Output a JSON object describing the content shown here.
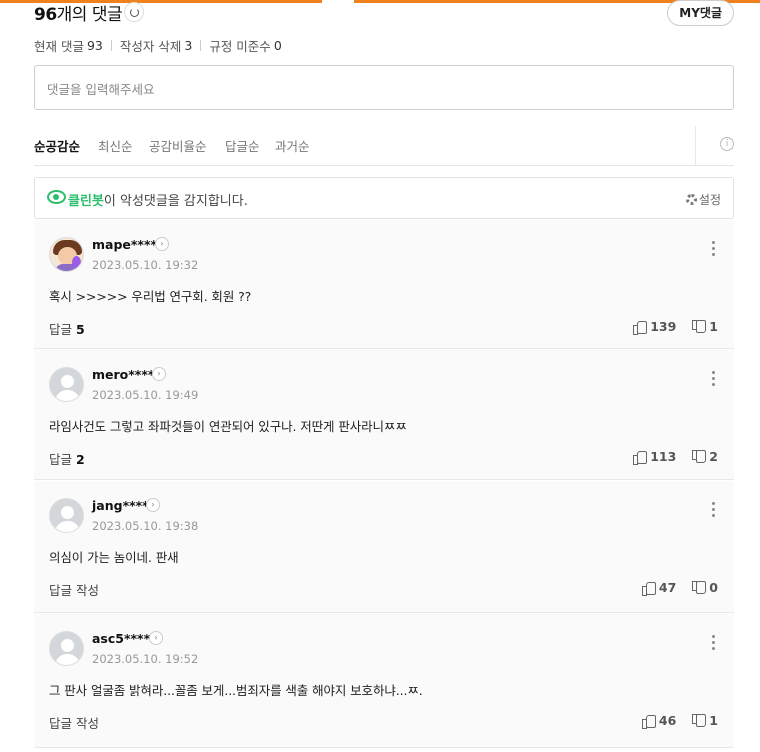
{
  "header": {
    "count": "96",
    "title_rest": "개의 댓글",
    "my_button": "MY댓글"
  },
  "stats": {
    "current_label": "현재 댓글",
    "current_value": "93",
    "deleted_label": "작성자 삭제",
    "deleted_value": "3",
    "violation_label": "규정 미준수",
    "violation_value": "0"
  },
  "input": {
    "placeholder": "댓글을 입력해주세요"
  },
  "sort_tabs": [
    "순공감순",
    "최신순",
    "공감비율순",
    "답글순",
    "과거순"
  ],
  "cleanbot": {
    "brand": "클린봇",
    "message": "이 악성댓글을 감지합니다.",
    "settings_label": "설정"
  },
  "comments": [
    {
      "author": "mape****",
      "date": "2023.05.10. 19:32",
      "content": "혹시 >>>>> 우리법 연구회. 회원 ??",
      "reply_label": "답글",
      "reply_count": "5",
      "likes": "139",
      "dislikes": "1"
    },
    {
      "author": "mero****",
      "date": "2023.05.10. 19:49",
      "content": "라임사건도 그렇고 좌파것들이 연관되어 있구나. 저딴게 판사라니ㅉㅉ",
      "reply_label": "답글",
      "reply_count": "2",
      "likes": "113",
      "dislikes": "2"
    },
    {
      "author": "jang****",
      "date": "2023.05.10. 19:38",
      "content": "의심이 가는 놈이네. 판새",
      "reply_label": "답글 작성",
      "reply_count": "",
      "likes": "47",
      "dislikes": "0"
    },
    {
      "author": "asc5****",
      "date": "2023.05.10. 19:52",
      "content": "그 판사 얼굴좀 밝혀라...꼴좀 보게...범죄자를 색출 해야지 보호하냐...ㅉ.",
      "reply_label": "답글 작성",
      "reply_count": "",
      "likes": "46",
      "dislikes": "1"
    }
  ]
}
